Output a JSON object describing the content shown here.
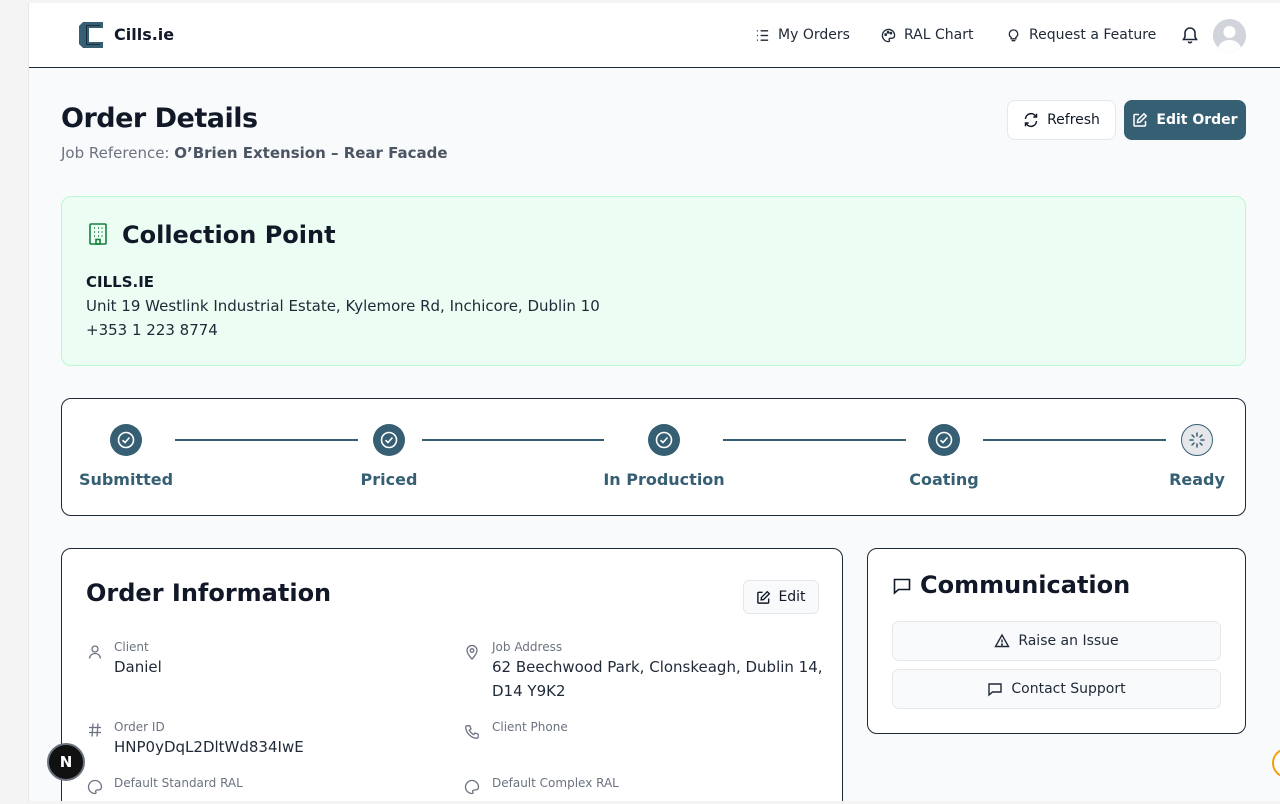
{
  "header": {
    "brand": "Cills.ie",
    "nav": {
      "my_orders": "My Orders",
      "ral_chart": "RAL Chart",
      "request_feature": "Request a Feature"
    }
  },
  "page": {
    "title": "Order Details",
    "job_reference_label": "Job Reference:",
    "job_reference_value": "O’Brien Extension – Rear Facade",
    "refresh_label": "Refresh",
    "edit_order_label": "Edit Order"
  },
  "collection_point": {
    "title": "Collection Point",
    "name": "CILLS.IE",
    "address": "Unit 19 Westlink Industrial Estate, Kylemore Rd, Inchicore, Dublin 10",
    "phone": "+353 1 223 8774"
  },
  "progress": {
    "steps": [
      {
        "label": "Submitted",
        "status": "complete"
      },
      {
        "label": "Priced",
        "status": "complete"
      },
      {
        "label": "In Production",
        "status": "complete"
      },
      {
        "label": "Coating",
        "status": "complete"
      },
      {
        "label": "Ready",
        "status": "pending"
      }
    ]
  },
  "order_info": {
    "title": "Order Information",
    "edit_label": "Edit",
    "client_label": "Client",
    "client_value": "Daniel",
    "job_address_label": "Job Address",
    "job_address_line1": "62 Beechwood Park, Clonskeagh, Dublin 14,",
    "job_address_line2": "D14 Y9K2",
    "order_id_label": "Order ID",
    "order_id_value": "HNP0yDqL2DltWd834IwE",
    "client_phone_label": "Client Phone",
    "default_standard_ral_label": "Default Standard RAL",
    "default_complex_ral_label": "Default Complex RAL"
  },
  "communication": {
    "title": "Communication",
    "raise_issue_label": "Raise an Issue",
    "contact_support_label": "Contact Support"
  },
  "floating": {
    "badge_letter": "N"
  },
  "colors": {
    "primary": "#365f74",
    "collection_bg": "#ecfdf3",
    "collection_border": "#bbf7d0"
  }
}
